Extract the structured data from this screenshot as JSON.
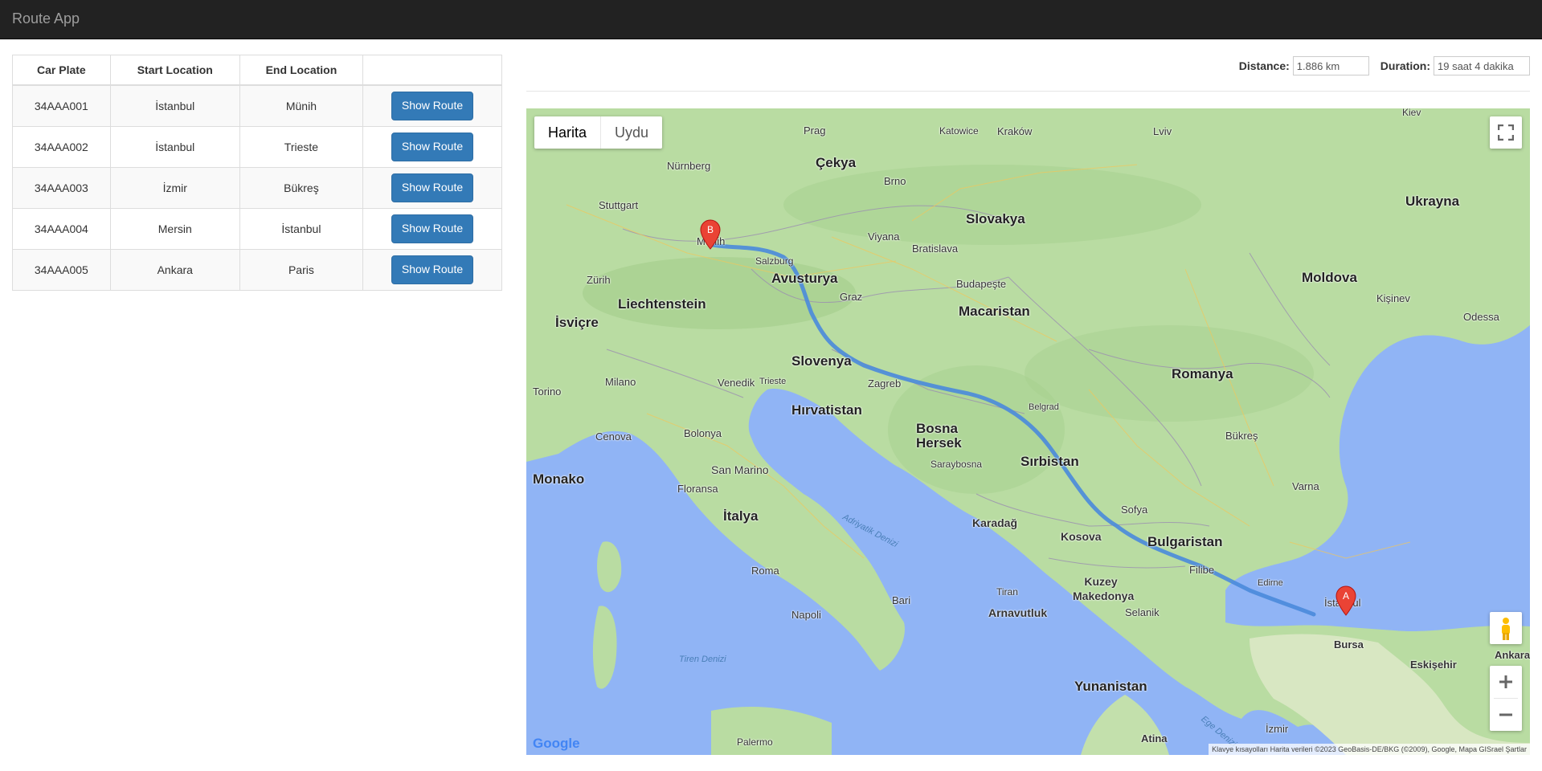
{
  "app": {
    "title": "Route App"
  },
  "table": {
    "headers": [
      "Car Plate",
      "Start Location",
      "End Location",
      ""
    ],
    "rows": [
      {
        "plate": "34AAA001",
        "start": "İstanbul",
        "end": "Münih",
        "action": "Show Route"
      },
      {
        "plate": "34AAA002",
        "start": "İstanbul",
        "end": "Trieste",
        "action": "Show Route"
      },
      {
        "plate": "34AAA003",
        "start": "İzmir",
        "end": "Bükreş",
        "action": "Show Route"
      },
      {
        "plate": "34AAA004",
        "start": "Mersin",
        "end": "İstanbul",
        "action": "Show Route"
      },
      {
        "plate": "34AAA005",
        "start": "Ankara",
        "end": "Paris",
        "action": "Show Route"
      }
    ]
  },
  "summary": {
    "distance_label": "Distance:",
    "distance_value": "1.886 km",
    "duration_label": "Duration:",
    "duration_value": "19 saat 4 dakika"
  },
  "map": {
    "type_map": "Harita",
    "type_satellite": "Uydu",
    "marker_start": "A",
    "marker_end": "B",
    "logo": "Google",
    "attribution": "Klavye kısayolları   Harita verileri ©2023 GeoBasis-DE/BKG (©2009), Google, Mapa GISrael   Şartlar",
    "colors": {
      "route": "#4a89dc",
      "marker": "#ea4335",
      "land": "#b9dca2",
      "sea": "#90b4f5"
    },
    "labels": [
      {
        "text": "Çekya",
        "kind": "country"
      },
      {
        "text": "Slovakya",
        "kind": "country"
      },
      {
        "text": "Ukrayna",
        "kind": "country"
      },
      {
        "text": "Avusturya",
        "kind": "country"
      },
      {
        "text": "Liechtenstein",
        "kind": "country"
      },
      {
        "text": "İsviçre",
        "kind": "country"
      },
      {
        "text": "Macaristan",
        "kind": "country"
      },
      {
        "text": "Moldova",
        "kind": "country"
      },
      {
        "text": "Romanya",
        "kind": "country"
      },
      {
        "text": "Slovenya",
        "kind": "country"
      },
      {
        "text": "Hırvatistan",
        "kind": "country"
      },
      {
        "text": "Bosna Hersek",
        "kind": "country"
      },
      {
        "text": "Sırbistan",
        "kind": "country"
      },
      {
        "text": "Monako",
        "kind": "country"
      },
      {
        "text": "San Marino",
        "kind": "country"
      },
      {
        "text": "İtalya",
        "kind": "country"
      },
      {
        "text": "Karadağ",
        "kind": "country"
      },
      {
        "text": "Kosova",
        "kind": "country"
      },
      {
        "text": "Bulgaristan",
        "kind": "country"
      },
      {
        "text": "Kuzey Makedonya",
        "kind": "country"
      },
      {
        "text": "Arnavutluk",
        "kind": "country"
      },
      {
        "text": "Yunanistan",
        "kind": "country"
      },
      {
        "text": "Münih",
        "kind": "city"
      },
      {
        "text": "Nürnberg",
        "kind": "city"
      },
      {
        "text": "Stuttgart",
        "kind": "city"
      },
      {
        "text": "Prag",
        "kind": "city"
      },
      {
        "text": "Brno",
        "kind": "city"
      },
      {
        "text": "Viyana",
        "kind": "city"
      },
      {
        "text": "Bratislava",
        "kind": "city"
      },
      {
        "text": "Budapeşte",
        "kind": "city"
      },
      {
        "text": "Salzburg",
        "kind": "city"
      },
      {
        "text": "Graz",
        "kind": "city"
      },
      {
        "text": "Zürih",
        "kind": "city"
      },
      {
        "text": "Milano",
        "kind": "city"
      },
      {
        "text": "Torino",
        "kind": "city"
      },
      {
        "text": "Venedik",
        "kind": "city"
      },
      {
        "text": "Trieste",
        "kind": "city"
      },
      {
        "text": "Zagreb",
        "kind": "city"
      },
      {
        "text": "Cenova",
        "kind": "city"
      },
      {
        "text": "Bolonya",
        "kind": "city"
      },
      {
        "text": "Floransa",
        "kind": "city"
      },
      {
        "text": "Roma",
        "kind": "city"
      },
      {
        "text": "Napoli",
        "kind": "city"
      },
      {
        "text": "Bari",
        "kind": "city"
      },
      {
        "text": "Palermo",
        "kind": "city"
      },
      {
        "text": "Saraybosna",
        "kind": "city"
      },
      {
        "text": "Belgrad",
        "kind": "city"
      },
      {
        "text": "Bükreş",
        "kind": "city"
      },
      {
        "text": "Sofya",
        "kind": "city"
      },
      {
        "text": "Filibe",
        "kind": "city"
      },
      {
        "text": "Varna",
        "kind": "city"
      },
      {
        "text": "Edirne",
        "kind": "city"
      },
      {
        "text": "İstanbul",
        "kind": "city"
      },
      {
        "text": "Bursa",
        "kind": "city"
      },
      {
        "text": "Eskişehir",
        "kind": "city"
      },
      {
        "text": "Ankara",
        "kind": "city"
      },
      {
        "text": "Selanik",
        "kind": "city"
      },
      {
        "text": "Tiran",
        "kind": "city"
      },
      {
        "text": "Atina",
        "kind": "city"
      },
      {
        "text": "İzmir",
        "kind": "city"
      },
      {
        "text": "Kişinev",
        "kind": "city"
      },
      {
        "text": "Odessa",
        "kind": "city"
      },
      {
        "text": "Lviv",
        "kind": "city"
      },
      {
        "text": "Kraków",
        "kind": "city"
      },
      {
        "text": "Katowice",
        "kind": "city"
      },
      {
        "text": "Kiev",
        "kind": "city"
      },
      {
        "text": "Adriyatik Denizi",
        "kind": "sea"
      },
      {
        "text": "Tiren Denizi",
        "kind": "sea"
      },
      {
        "text": "Ege Denizi",
        "kind": "sea"
      }
    ]
  }
}
